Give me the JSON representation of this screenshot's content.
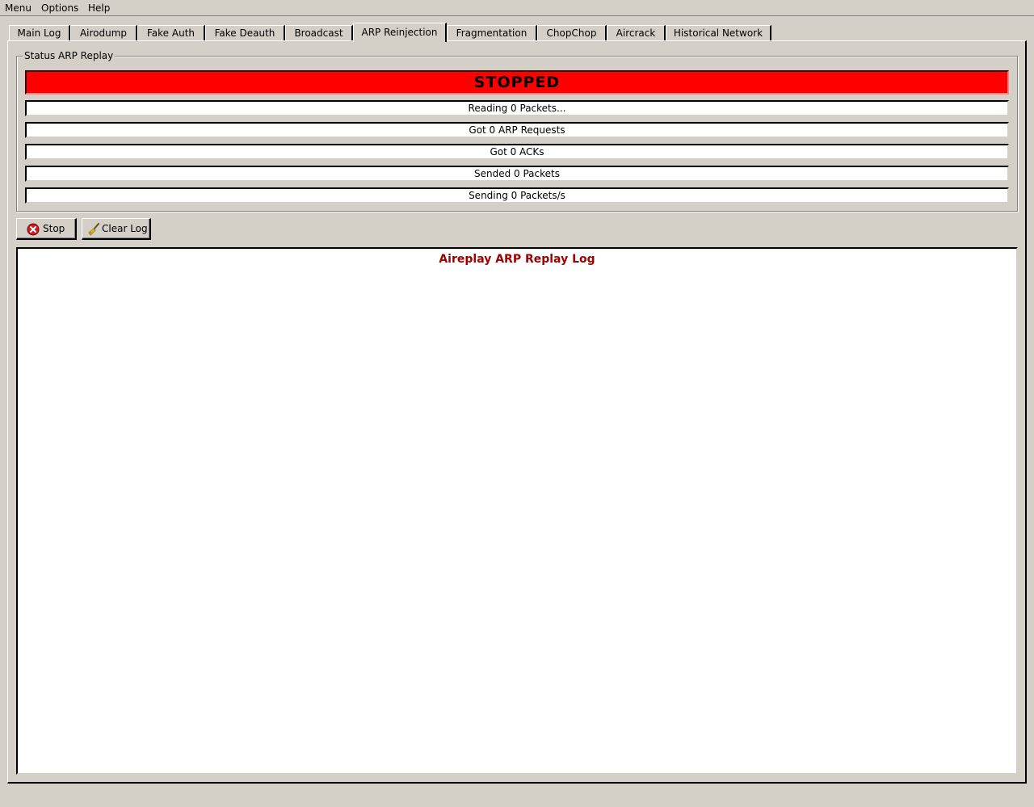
{
  "menubar": {
    "items": [
      "Menu",
      "Options",
      "Help"
    ]
  },
  "tabs": [
    {
      "label": "Main Log",
      "active": false
    },
    {
      "label": "Airodump",
      "active": false
    },
    {
      "label": "Fake Auth",
      "active": false
    },
    {
      "label": "Fake Deauth",
      "active": false
    },
    {
      "label": "Broadcast",
      "active": false
    },
    {
      "label": "ARP Reinjection",
      "active": true
    },
    {
      "label": "Fragmentation",
      "active": false
    },
    {
      "label": "ChopChop",
      "active": false
    },
    {
      "label": "Aircrack",
      "active": false
    },
    {
      "label": "Historical Network",
      "active": false
    }
  ],
  "status_group": {
    "title": "Status ARP Replay",
    "state": "STOPPED",
    "state_color": "#ff0000",
    "lines": [
      "Reading 0 Packets...",
      "Got 0 ARP Requests",
      "Got 0 ACKs",
      "Sended 0 Packets",
      "Sending 0 Packets/s"
    ]
  },
  "toolbar": {
    "stop_label": "Stop",
    "stop_icon": "stop-icon",
    "clear_label": "Clear Log",
    "clear_icon": "broom-icon"
  },
  "log": {
    "title": "Aireplay ARP Replay Log",
    "title_color": "#a00000",
    "lines": []
  }
}
